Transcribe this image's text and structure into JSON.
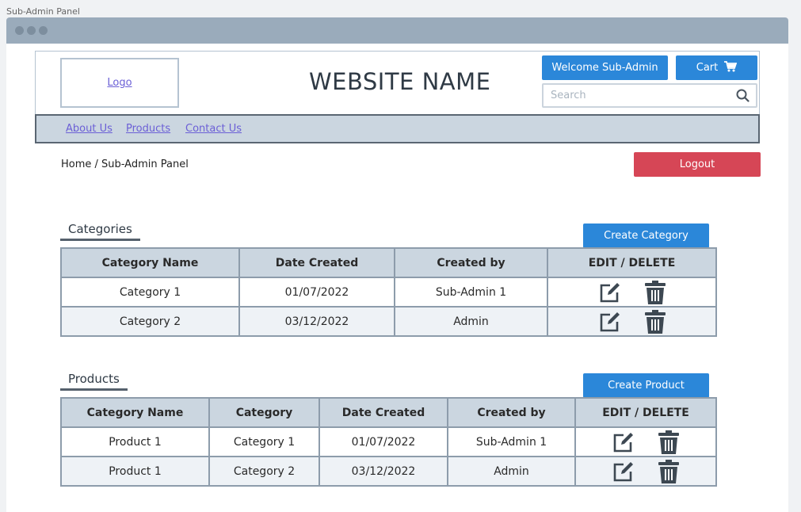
{
  "page_label": "Sub-Admin Panel",
  "header": {
    "logo_text": "Logo",
    "site_name": "WEBSITE NAME",
    "welcome_label": "Welcome Sub-Admin",
    "cart_label": "Cart",
    "search_placeholder": "Search"
  },
  "nav": {
    "items": [
      {
        "label": "About Us"
      },
      {
        "label": "Products"
      },
      {
        "label": "Contact Us"
      }
    ]
  },
  "breadcrumb": "Home / Sub-Admin Panel",
  "logout_label": "Logout",
  "categories": {
    "title": "Categories",
    "create_label": "Create Category",
    "headers": [
      "Category Name",
      "Date Created",
      "Created by",
      "EDIT / DELETE"
    ],
    "rows": [
      {
        "name": "Category 1",
        "date": "01/07/2022",
        "by": "Sub-Admin 1"
      },
      {
        "name": "Category 2",
        "date": "03/12/2022",
        "by": "Admin"
      }
    ]
  },
  "products": {
    "title": "Products",
    "create_label": "Create Product",
    "headers": [
      "Category Name",
      "Category",
      "Date Created",
      "Created by",
      "EDIT / DELETE"
    ],
    "rows": [
      {
        "name": "Product 1",
        "category": "Category 1",
        "date": "01/07/2022",
        "by": "Sub-Admin 1"
      },
      {
        "name": "Product 1",
        "category": "Category 2",
        "date": "03/12/2022",
        "by": "Admin"
      }
    ]
  },
  "icons": {
    "edit": "edit-icon",
    "delete": "trash-icon",
    "cart": "cart-icon",
    "search": "search-icon"
  },
  "colors": {
    "primary": "#2b87d9",
    "danger": "#d64656",
    "nav_bg": "#cbd6e0",
    "titlebar": "#9aabbb"
  }
}
